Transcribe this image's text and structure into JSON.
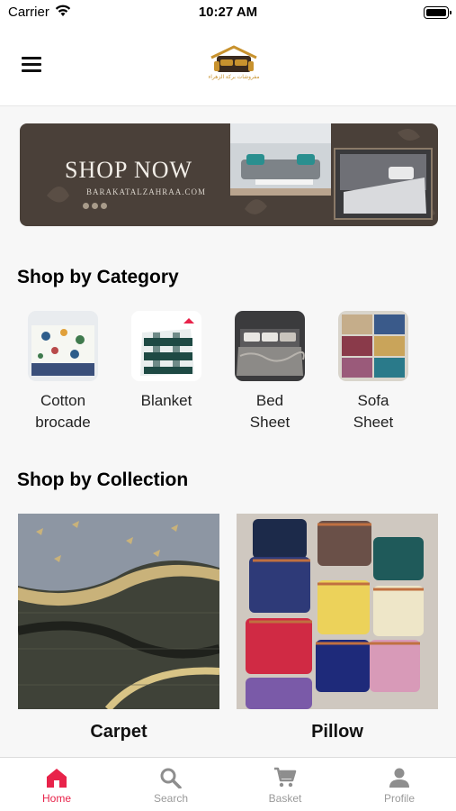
{
  "status_bar": {
    "carrier": "Carrier",
    "time": "10:27 AM"
  },
  "header": {
    "logo_text": "مفروشات بركة الزهراء"
  },
  "banner": {
    "title": "SHOP NOW",
    "subtitle": "BARAKATALZAHRAA.COM"
  },
  "categories": {
    "title": "Shop by Category",
    "items": [
      {
        "label": "Cotton\nbrocade"
      },
      {
        "label": "Blanket"
      },
      {
        "label": "Bed\nSheet"
      },
      {
        "label": "Sofa\nSheet"
      }
    ]
  },
  "collections": {
    "title": "Shop by Collection",
    "items": [
      {
        "label": "Carpet"
      },
      {
        "label": "Pillow"
      }
    ]
  },
  "tabbar": {
    "active": "home",
    "items": [
      {
        "label": "Home",
        "icon": "home-icon"
      },
      {
        "label": "Search",
        "icon": "search-icon"
      },
      {
        "label": "Basket",
        "icon": "cart-icon"
      },
      {
        "label": "Profile",
        "icon": "person-icon"
      }
    ]
  },
  "colors": {
    "accent": "#e8234a",
    "brand": "#c8922e",
    "banner_bg": "#4a4039",
    "tab_inactive": "#9a9a9a"
  }
}
